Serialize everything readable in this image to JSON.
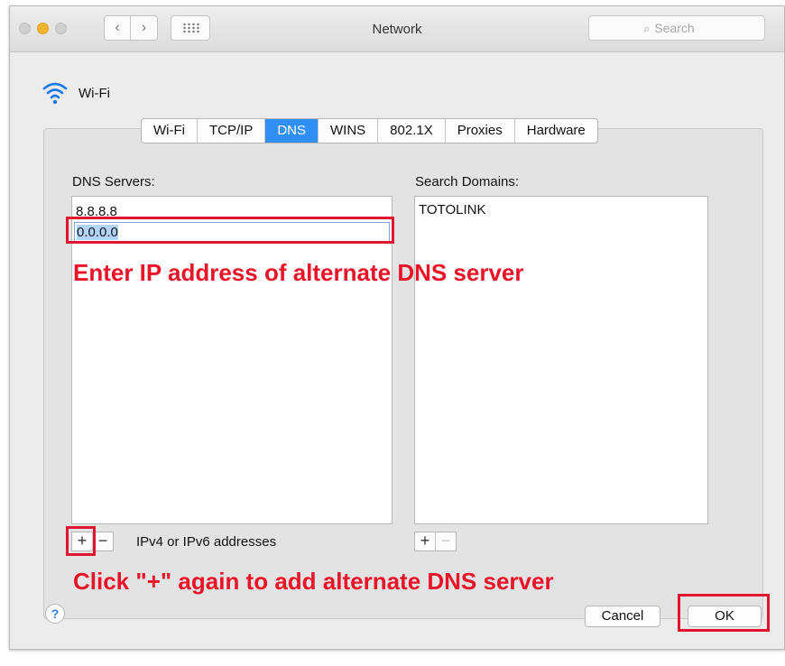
{
  "window": {
    "title": "Network",
    "search_placeholder": "Search"
  },
  "nav": {
    "back_icon": "chevron-left",
    "forward_icon": "chevron-right",
    "grid_icon": "grid-dots"
  },
  "interface": {
    "name": "Wi-Fi",
    "icon": "wifi-icon"
  },
  "tabs": [
    {
      "label": "Wi-Fi"
    },
    {
      "label": "TCP/IP"
    },
    {
      "label": "DNS",
      "active": true
    },
    {
      "label": "WINS"
    },
    {
      "label": "802.1X"
    },
    {
      "label": "Proxies"
    },
    {
      "label": "Hardware"
    }
  ],
  "dns": {
    "label": "DNS Servers:",
    "servers": [
      "8.8.8.8",
      "0.0.0.0"
    ],
    "hint": "IPv4 or IPv6 addresses"
  },
  "search_domains": {
    "label": "Search Domains:",
    "domains": [
      "TOTOLINK"
    ]
  },
  "controls": {
    "add": "+",
    "remove": "−"
  },
  "annotations": {
    "enter_ip": "Enter IP address of alternate DNS server",
    "click_plus": "Click \"+\" again to add alternate DNS server"
  },
  "buttons": {
    "help": "?",
    "cancel": "Cancel",
    "ok": "OK"
  },
  "colors": {
    "accent": "#2f8ff5",
    "annotation": "#ea1328",
    "traffic_minimize": "#f5b52a"
  }
}
